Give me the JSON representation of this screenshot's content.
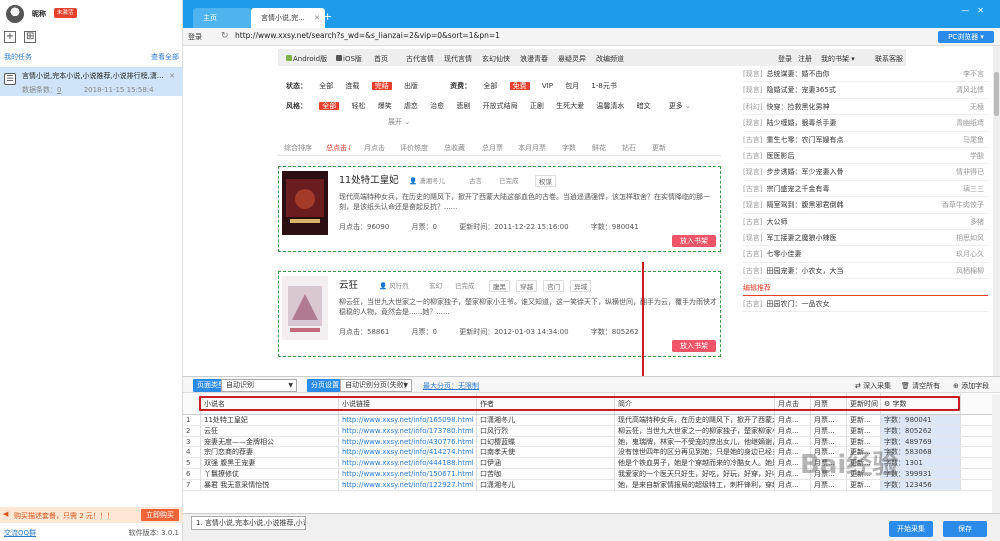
{
  "user": {
    "nickname": "昵称",
    "vip_badge": "未激活"
  },
  "left": {
    "my_tasks": "我的任务",
    "view_all": "查看全部",
    "task": {
      "name": "言情小说,完本小说,小说推荐,小说排行榜,潇...",
      "count_label": "数据条数：",
      "count": "0",
      "time": "2018-11-15 15:58:4"
    },
    "promo_text": "购买描述套餐，只需 2 元！！！",
    "promo_button": "立即购买",
    "qq_group": "交流QQ群",
    "version": "软件版本: 3.0.1"
  },
  "tabs": {
    "home": "主页",
    "active": "言情小说,完..."
  },
  "address": {
    "login": "登录",
    "url": "http://www.xxsy.net/search?s_wd=&s_lianzai=2&vip=0&sort=1&pn=1",
    "pc_browser": "PC浏览器"
  },
  "site": {
    "nav": [
      "Android版",
      "iOS版",
      "首页",
      "古代言情",
      "现代言情",
      "玄幻仙侠",
      "浪漫青春",
      "悬疑灵异",
      "改编频道"
    ],
    "right": [
      "登录",
      "注册",
      "我的书架",
      "联系客服"
    ]
  },
  "filters": {
    "status_label": "状态：",
    "status": [
      "全部",
      "连载",
      "完结",
      "出版"
    ],
    "fee_label": "资费：",
    "fee": [
      "全部",
      "免费",
      "VIP",
      "包月",
      "1-8元书"
    ],
    "style_label": "风格：",
    "style": [
      "全部",
      "轻松",
      "爆笑",
      "虐恋",
      "治愈",
      "悲剧",
      "开放式结局",
      "正剧",
      "生死大爱",
      "温馨清水",
      "暗文"
    ],
    "more": "更多",
    "expand": "展开"
  },
  "sort": [
    "综合排序",
    "总点击",
    "月点击",
    "评价热度",
    "总收藏",
    "总月票",
    "本月月票",
    "字数",
    "鲜花",
    "钻石",
    "更新"
  ],
  "books": [
    {
      "title": "11处特工皇妃",
      "author": "潇湘冬儿",
      "genre": "古言",
      "status": "已完成",
      "tags": [
        "权谋"
      ],
      "desc": "现代高端特种女兵，在历史的飓风下，掀开了西蒙大陆这部血色的古卷。当逍遥遇强悍，该怎样取舍？在实情降临的那一刻，是该纸头认命还是奋起反抗？......",
      "month_click": "月点击：96090",
      "month_ticket": "月票：0",
      "update": "更新时间：2011-12-22 15:16:00",
      "words": "字数：980041",
      "add": "放入书架"
    },
    {
      "title": "云狂",
      "author": "风行烈",
      "genre": "玄幻",
      "status": "已完成",
      "tags": [
        "腹黑",
        "穿越",
        "宫门",
        "异域"
      ],
      "desc": "柳云狂，当世九大世家之一的柳家独子，楚家柳家小王爷。谁又知道，这一笑徐天下，纵横世间，翻手为云，覆手为雨侠才稳稳的人物，竟然会是......她？......",
      "month_click": "月点击：58861",
      "month_ticket": "月票：0",
      "update": "更新时间：2012-01-03 14:34:00",
      "words": "字数：805262",
      "add": "放入书架"
    }
  ],
  "rank": {
    "list": [
      {
        "cat": "[现言]",
        "name": "总统谋妻：婚不由你",
        "author": "李不言"
      },
      {
        "cat": "[现言]",
        "name": "隐婚试爱：宠妻365式",
        "author": "清风北悸"
      },
      {
        "cat": "[科幻]",
        "name": "快穿：捡救黑化男神",
        "author": "无極"
      },
      {
        "cat": "[现言]",
        "name": "陆少缠婚，狠毒杀手妻",
        "author": "青幽纸鸢"
      },
      {
        "cat": "[古言]",
        "name": "重生七零：农门军嫂有点",
        "author": "马尾鱼"
      },
      {
        "cat": "[古言]",
        "name": "医医影后",
        "author": "学酸"
      },
      {
        "cat": "[现言]",
        "name": "步步诱婚：军少宠妻入骨",
        "author": "情非得已"
      },
      {
        "cat": "[古言]",
        "name": "宗门盛宠之千金有毒",
        "author": "璃三三"
      },
      {
        "cat": "[现言]",
        "name": "隔室驾到：腹黑邪君倒韩",
        "author": "香草牛肉饺子"
      },
      {
        "cat": "[古言]",
        "name": "大公师",
        "author": "多猪"
      },
      {
        "cat": "[现言]",
        "name": "军工接妻之魔狼小辣医",
        "author": "相思如风"
      },
      {
        "cat": "[古言]",
        "name": "七零小佳妻",
        "author": "玖月心久"
      },
      {
        "cat": "[古言]",
        "name": "田园宠妻：小农女，大当",
        "author": "风栖棉柳"
      }
    ],
    "recommend_title": "编辑推荐",
    "recommend_first": {
      "cat": "[古言]",
      "name": "田园农门：一品农女",
      "author": ""
    }
  },
  "toolbar": {
    "page_type_label": "页面类型",
    "page_type_value": "自动识别",
    "paging_label": "分页设置",
    "paging_value": "自动识别分页(失败)",
    "max_pages": "最大分页：无限制",
    "deep_collect": "深入采集",
    "clear_all": "清空所有",
    "add_field": "添加字段"
  },
  "grid": {
    "headers": [
      "小说名",
      "小说链接",
      "作者",
      "简介",
      "月点击",
      "月票",
      "更新时间",
      "字数"
    ],
    "rows": [
      [
        "1",
        "11处特工皇妃",
        "http://www.xxsy.net/info/165098.html",
        "口潇湘冬儿",
        "现代高端特种女兵，在历史的飓风下，掀开了西蒙大...",
        "月点...",
        "月票...",
        "更新...",
        "字数：980041"
      ],
      [
        "2",
        "云狂",
        "http://www.xxsy.net/info/173780.html",
        "口风行烈",
        "柳云狂，当世九大世家之一的柳家独子，楚家柳家小...",
        "月点...",
        "月票...",
        "更新...",
        "字数：805262"
      ],
      [
        "3",
        "宠妻无度——金牌相公",
        "http://www.xxsy.net/info/430776.html",
        "口幻樱蓝蝶",
        "她，鬼瑞牌，林家一不受宠的庶出女儿，他继嫡谢，他...",
        "月点...",
        "月票...",
        "更新...",
        "字数：489769"
      ],
      [
        "4",
        "宗门恋商的荐妻",
        "http://www.xxsy.net/info/414274.html",
        "口南孝天使",
        "没有惊世四年的区分再见到她；只是她的身边已经多...",
        "月点...",
        "月票...",
        "更新...",
        "字数：583068"
      ],
      [
        "5",
        "双强 腹黑王宠妻",
        "http://www.xxsy.net/info/444188.html",
        "口伊涵",
        "他是个铁血男子，她是个穿越而来的冷酷女人。她是个时装...",
        "月点...",
        "月票...",
        "更新...",
        "字数：1301"
      ],
      [
        "6",
        "丫鬟撩修仗",
        "http://www.xxsy.net/info/150671.html",
        "口苦咖",
        "我爱家的一个医天只好生，好吃，好玩，好穿，好收...",
        "月点...",
        "月票...",
        "更新...",
        "字数：399931"
      ],
      [
        "7",
        "暴君 我无意采情怡悦",
        "http://www.xxsy.net/info/122927.html",
        "口潇湘冬儿",
        "她，是来自新家情报局的超级特工，刺杆锋利，穿越...",
        "月点...",
        "月票...",
        "更新...",
        "字数：123456"
      ]
    ]
  },
  "bottom": {
    "task_tab": "1. 言情小说,完本小说,小说推荐,小说...",
    "start": "开始采集",
    "save": "保存"
  },
  "watermark": "Bai经验"
}
